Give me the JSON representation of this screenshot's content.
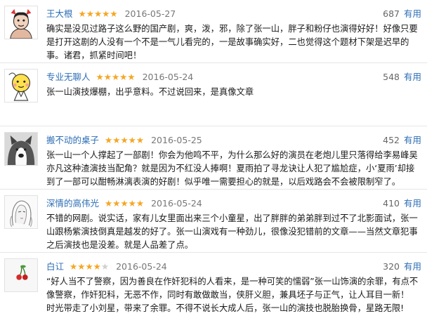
{
  "reviews": [
    {
      "user": "王大根",
      "rating": 5,
      "date": "2016-05-27",
      "useful_count": "687",
      "useful_label": "有用",
      "content": "确实是没见过路子这么野的国产剧，爽，泼，邪，除了张一山，胖子和粉仔也演得好好！好像只要是打开这剧的人没有一个不是一气儿看完的，一是故事确实好，二也觉得这个题材下架是迟早的事。诸君，抓紧时间吧！",
      "avatar": "cartoon-man-avatar"
    },
    {
      "user": "专业无聊人",
      "rating": 5,
      "date": "2016-05-24",
      "useful_count": "548",
      "useful_label": "有用",
      "content": "张一山演技爆棚，出乎意料。不过说回来，是真像文章",
      "avatar": "yellow-emoji-avatar"
    },
    {
      "user": "搬不动的桌子",
      "rating": 5,
      "date": "2016-05-25",
      "useful_count": "452",
      "useful_label": "有用",
      "content": "张一山一个人撑起了一部剧！你会为他鸣不平，为什么那么好的演员在老炮儿里只落得给李易峰吴亦凡这种渣演技当配角？就是因为不红没人捧啊！夏雨拍了寻龙诀让人犯了尴尬症，小‘夏雨’却接到了一部可以酣畅淋漓表演的好剧！似乎唯一需要担心的就是，以后戏路会不会被限制窄了。",
      "avatar": "husky-dog-avatar"
    },
    {
      "user": "深情的高伟光",
      "rating": 5,
      "date": "2016-05-24",
      "useful_count": "410",
      "useful_label": "有用",
      "content": "不错的网剧。说实话，家有儿女里面出来三个小童星，出了胖胖的弟弟胖到过不了北影面试，张一山跟杨紫演技倒真是越发的好了。张一山演戏有一种劲儿，很像没犯错前的文章——当然文章犯事之后演技也是没差。就是人品差了点。",
      "avatar": "sketch-woman-avatar"
    },
    {
      "user": "白讧",
      "rating": 4,
      "date": "2016-05-24",
      "useful_count": "320",
      "useful_label": "有用",
      "content": "“好人当不了警察，因为善良在作奸犯科的人看来，是一种可笑的懦弱”张一山饰演的余罪，有点不像警察，作奸犯科，无恶不作，同时有敢做敢当，侠肝义胆，兼具坯子与正气，让人耳目一新！ 时光带走了小刘星，带来了余罪。不得不说长大成人后，张一山的演技也脱胎换骨，星路无限!",
      "avatar": "cherry-avatar"
    }
  ],
  "colors": {
    "username": "#2c6eb5",
    "star_on": "#f5a623",
    "star_off": "#cfcfcf"
  }
}
